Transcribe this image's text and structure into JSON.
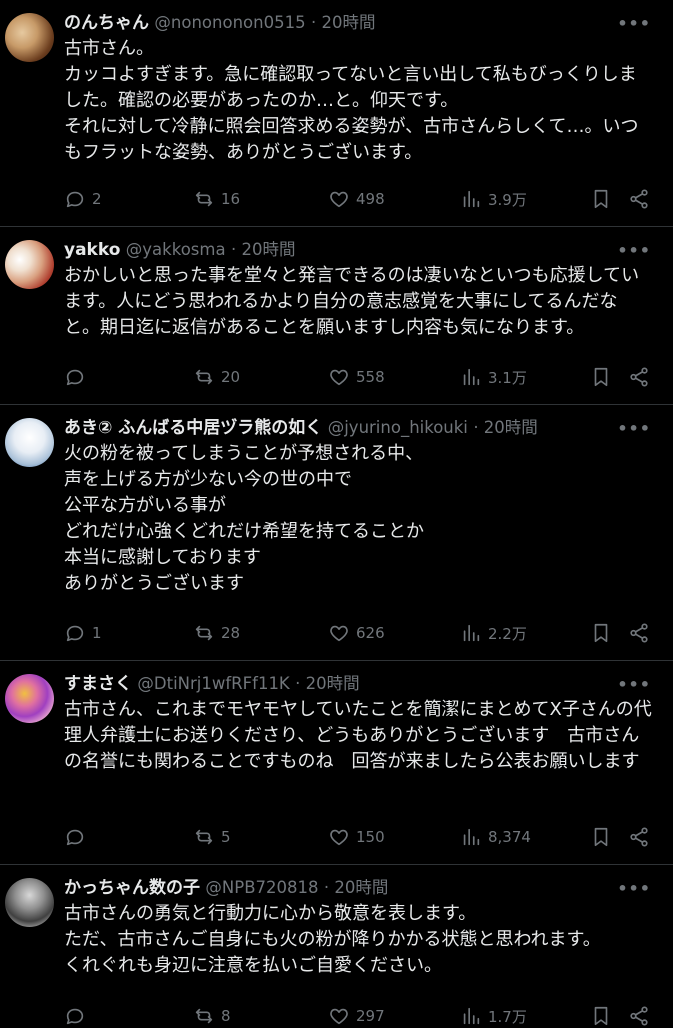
{
  "tweets": [
    {
      "name": "のんちゃん",
      "handle": "@nonononon0515",
      "time": "· 20時間",
      "text": "古市さん。\nカッコよすぎます。急に確認取ってないと言い出して私もびっくりしました。確認の必要があったのか…と。仰天です。\nそれに対して冷静に照会回答求める姿勢が、古市さんらしくて…。いつもフラットな姿勢、ありがとうございます。",
      "replies": "2",
      "retweets": "16",
      "likes": "498",
      "views": "3.9万"
    },
    {
      "name": "yakko",
      "handle": "@yakkosma",
      "time": "· 20時間",
      "text": "おかしいと思った事を堂々と発言できるのは凄いなといつも応援しています。人にどう思われるかより自分の意志感覚を大事にしてるんだなと。期日迄に返信があることを願いますし内容も気になります。",
      "replies": "",
      "retweets": "20",
      "likes": "558",
      "views": "3.1万"
    },
    {
      "name": "あき② ふんばる中居ヅラ熊の如く",
      "handle": "@jyurino_hikouki",
      "time": "· 20時間",
      "text": "火の粉を被ってしまうことが予想される中、\n声を上げる方が少ない今の世の中で\n公平な方がいる事が\nどれだけ心強くどれだけ希望を持てることか\n本当に感謝しております\nありがとうございます",
      "replies": "1",
      "retweets": "28",
      "likes": "626",
      "views": "2.2万"
    },
    {
      "name": "すまさく",
      "handle": "@DtiNrj1wfRFf11K",
      "time": "· 20時間",
      "text": "古市さん、これまでモヤモヤしていたことを簡潔にまとめてX子さんの代理人弁護士にお送りくださり、どうもありがとうございます　古市さんの名誉にも関わることですものね　回答が来ましたら公表お願いします",
      "replies": "",
      "retweets": "5",
      "likes": "150",
      "views": "8,374"
    },
    {
      "name": "かっちゃん数の子",
      "handle": "@NPB720818",
      "time": "· 20時間",
      "text": "古市さんの勇気と行動力に心から敬意を表します。\nただ、古市さんご自身にも火の粉が降りかかる状態と思われます。\nくれぐれも身辺に注意を払いご自愛ください。",
      "replies": "",
      "retweets": "8",
      "likes": "297",
      "views": "1.7万"
    }
  ],
  "icons": {
    "reply": "reply-icon",
    "retweet": "retweet-icon",
    "like": "like-icon",
    "views": "views-icon",
    "bookmark": "bookmark-icon",
    "share": "share-icon",
    "more": "more-icon"
  },
  "colors": {
    "background": "#000000",
    "text": "#e7e9ea",
    "muted": "#71767b",
    "divider": "#2f3336"
  }
}
